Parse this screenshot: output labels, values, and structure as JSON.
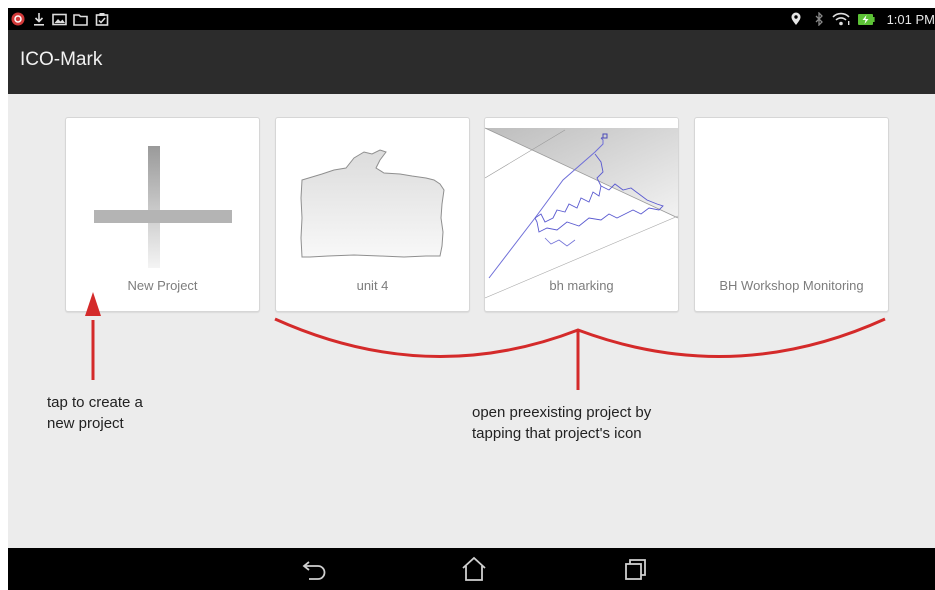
{
  "status_bar": {
    "time": "1:01 PM",
    "left_icons": [
      "app-notification-icon",
      "download-icon",
      "gallery-icon",
      "folder-icon",
      "clipboard-icon"
    ],
    "right_icons": [
      "location-icon",
      "bluetooth-icon",
      "wifi-icon",
      "battery-charging-icon"
    ]
  },
  "app_bar": {
    "title": "ICO-Mark"
  },
  "tiles": [
    {
      "label": "New Project",
      "icon": "plus-icon"
    },
    {
      "label": "unit 4",
      "icon": "map-shape-thumbnail"
    },
    {
      "label": "bh marking",
      "icon": "track-map-thumbnail"
    },
    {
      "label": "BH Workshop Monitoring",
      "icon": "blank-thumbnail"
    }
  ],
  "annotations": {
    "left": [
      "tap to create a",
      "new project"
    ],
    "right": [
      "open preexisting project by",
      "tapping that project's icon"
    ],
    "arrow_color": "#d42a2a"
  },
  "nav_bar": {
    "icons": [
      "back-icon",
      "home-icon",
      "recents-icon"
    ]
  }
}
